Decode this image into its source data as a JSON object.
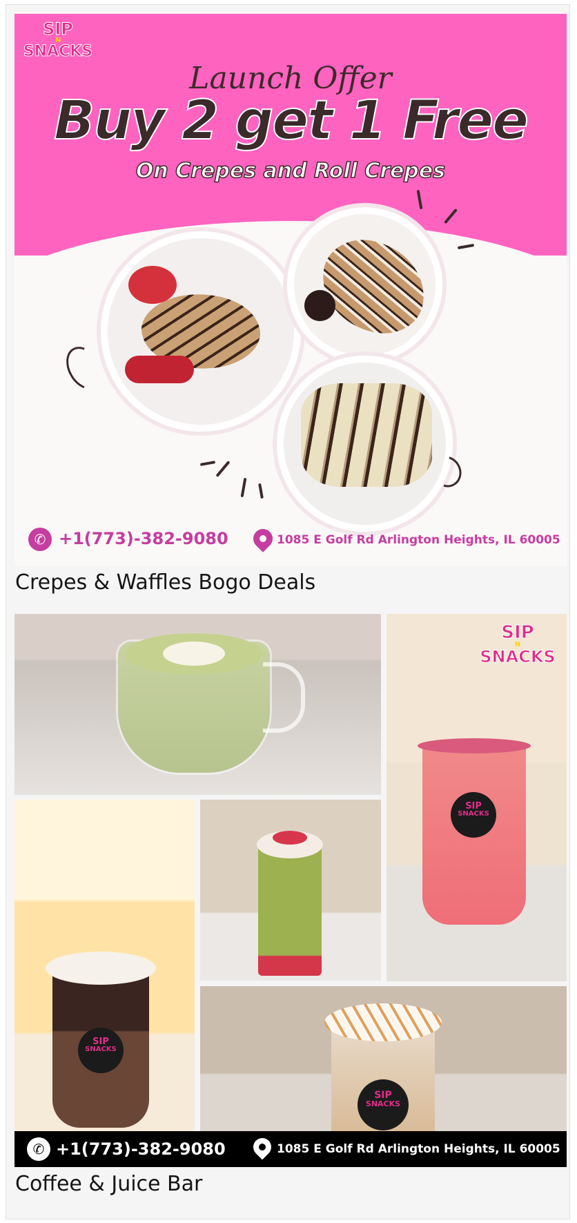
{
  "posts": [
    {
      "banner": {
        "logo": {
          "line1": "SIP",
          "amp": "N",
          "line2": "SNACKS"
        },
        "kicker": "Launch Offer",
        "headline": "Buy 2 get 1 Free",
        "subhead": "On Crepes and Roll Crepes",
        "phone": "+1(773)-382-9080",
        "address": "1085 E Golf Rd Arlington Heights, IL 60005",
        "colors": {
          "band": "#ff63c0",
          "accent": "#c53da0",
          "text": "#3a2a2a"
        }
      },
      "caption": "Crepes & Waffles Bogo Deals"
    },
    {
      "banner": {
        "logo": {
          "line1": "SIP",
          "amp": "N",
          "line2": "SNACKS"
        },
        "sticker": {
          "line1": "SIP",
          "line2": "SNACKS"
        },
        "phone": "+1(773)-382-9080",
        "address": "1085 E Golf Rd Arlington Heights, IL 60005",
        "colors": {
          "bar": "#000000",
          "text": "#ffffff"
        }
      },
      "caption": "Coffee & Juice Bar"
    }
  ],
  "icons": [
    "phone-icon",
    "location-pin-icon"
  ]
}
